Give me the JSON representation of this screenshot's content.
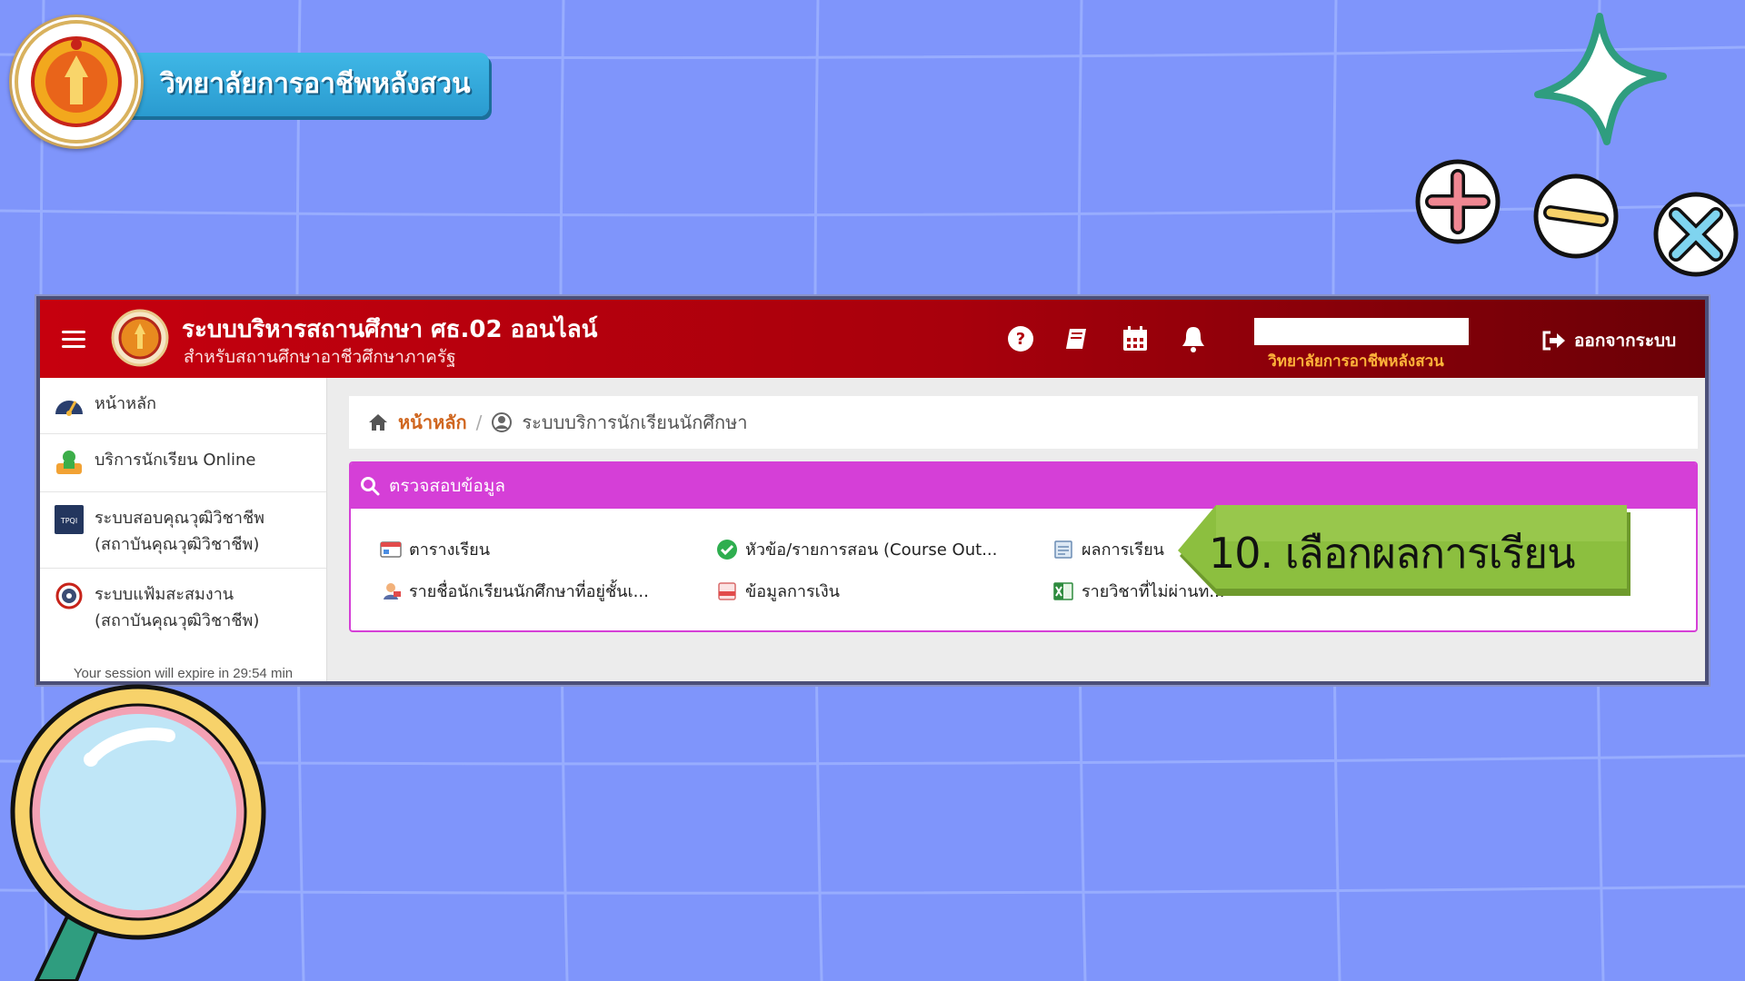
{
  "branding": {
    "college_name": "วิทยาลัยการอาชีพหลังสวน"
  },
  "header": {
    "system_title": "ระบบบริหารสถานศึกษา ศธ.02 ออนไลน์",
    "system_subtitle": "สำหรับสถานศึกษาอาชีวศึกษาภาครัฐ",
    "user_college": "วิทยาลัยการอาชีพหลังสวน",
    "logout_label": "ออกจากระบบ"
  },
  "sidebar": {
    "items": [
      {
        "label": "หน้าหลัก"
      },
      {
        "label": "บริการนักเรียน Online"
      },
      {
        "label": "ระบบสอบคุณวุฒิวิชาชีพ",
        "label2": "(สถาบันคุณวุฒิวิชาชีพ)"
      },
      {
        "label": "ระบบแฟ้มสะสมงาน",
        "label2": "(สถาบันคุณวุฒิวิชาชีพ)"
      }
    ],
    "session_text": "Your session will expire in 29:54 min"
  },
  "breadcrumb": {
    "home": "หน้าหลัก",
    "separator": "/",
    "current": "ระบบบริการนักเรียนนักศึกษา"
  },
  "panel": {
    "title": "ตรวจสอบข้อมูล",
    "links": [
      {
        "label": "ตารางเรียน"
      },
      {
        "label": "หัวข้อ/รายการสอน (Course Out..."
      },
      {
        "label": "ผลการเรียน"
      },
      {
        "label": "รายชื่อนักเรียนนักศึกษาที่อยู่ชั้นเ..."
      },
      {
        "label": "ข้อมูลการเงิน"
      },
      {
        "label": "รายวิชาที่ไม่ผ่านท..."
      }
    ]
  },
  "callout": {
    "text": "10. เลือกผลการเรียน"
  },
  "colors": {
    "background": "#7f95fb",
    "header_red": "#c6000e",
    "panel_magenta": "#d53fd7",
    "accent_orange": "#d0661f",
    "callout_green": "#8cbf3f"
  }
}
